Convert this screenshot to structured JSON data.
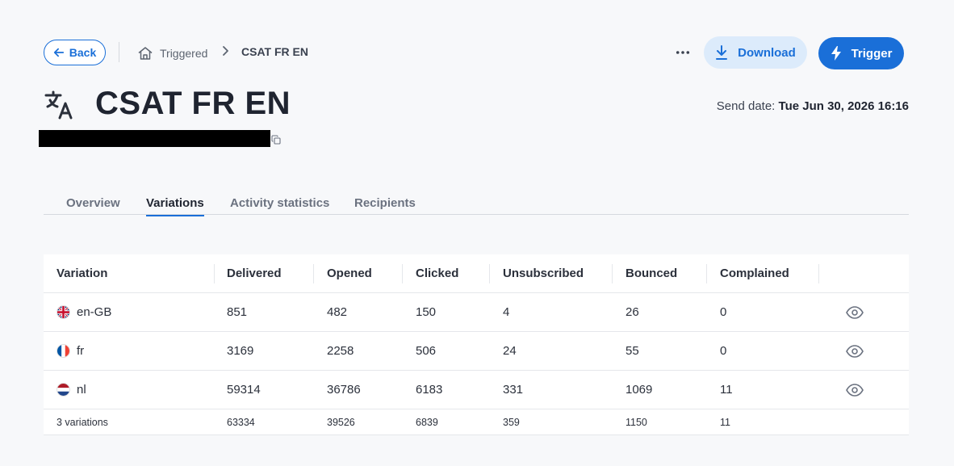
{
  "topbar": {
    "back_label": "Back",
    "breadcrumb_parent": "Triggered",
    "breadcrumb_current": "CSAT FR EN",
    "more_label": "···",
    "download_label": "Download",
    "trigger_label": "Trigger"
  },
  "title": "CSAT FR EN",
  "send_date": {
    "label": "Send date:",
    "value": "Tue Jun 30, 2026 16:16"
  },
  "tabs": [
    {
      "label": "Overview",
      "active": false
    },
    {
      "label": "Variations",
      "active": true
    },
    {
      "label": "Activity statistics",
      "active": false
    },
    {
      "label": "Recipients",
      "active": false
    }
  ],
  "table": {
    "headers": [
      "Variation",
      "Delivered",
      "Opened",
      "Clicked",
      "Unsubscribed",
      "Bounced",
      "Complained"
    ],
    "rows": [
      {
        "variation": "en-GB",
        "flag": "uk-flag-icon",
        "delivered": "851",
        "opened": "482",
        "clicked": "150",
        "unsubscribed": "4",
        "bounced": "26",
        "complained": "0"
      },
      {
        "variation": "fr",
        "flag": "france-flag-icon",
        "delivered": "3169",
        "opened": "2258",
        "clicked": "506",
        "unsubscribed": "24",
        "bounced": "55",
        "complained": "0"
      },
      {
        "variation": "nl",
        "flag": "netherlands-flag-icon",
        "delivered": "59314",
        "opened": "36786",
        "clicked": "6183",
        "unsubscribed": "331",
        "bounced": "1069",
        "complained": "11"
      }
    ],
    "totals": {
      "label": "3 variations",
      "delivered": "63334",
      "opened": "39526",
      "clicked": "6839",
      "unsubscribed": "359",
      "bounced": "1150",
      "complained": "11"
    }
  },
  "colors": {
    "accent": "#1a6fd8",
    "accent_light": "#dcebfb",
    "background": "#f7f8fa"
  }
}
